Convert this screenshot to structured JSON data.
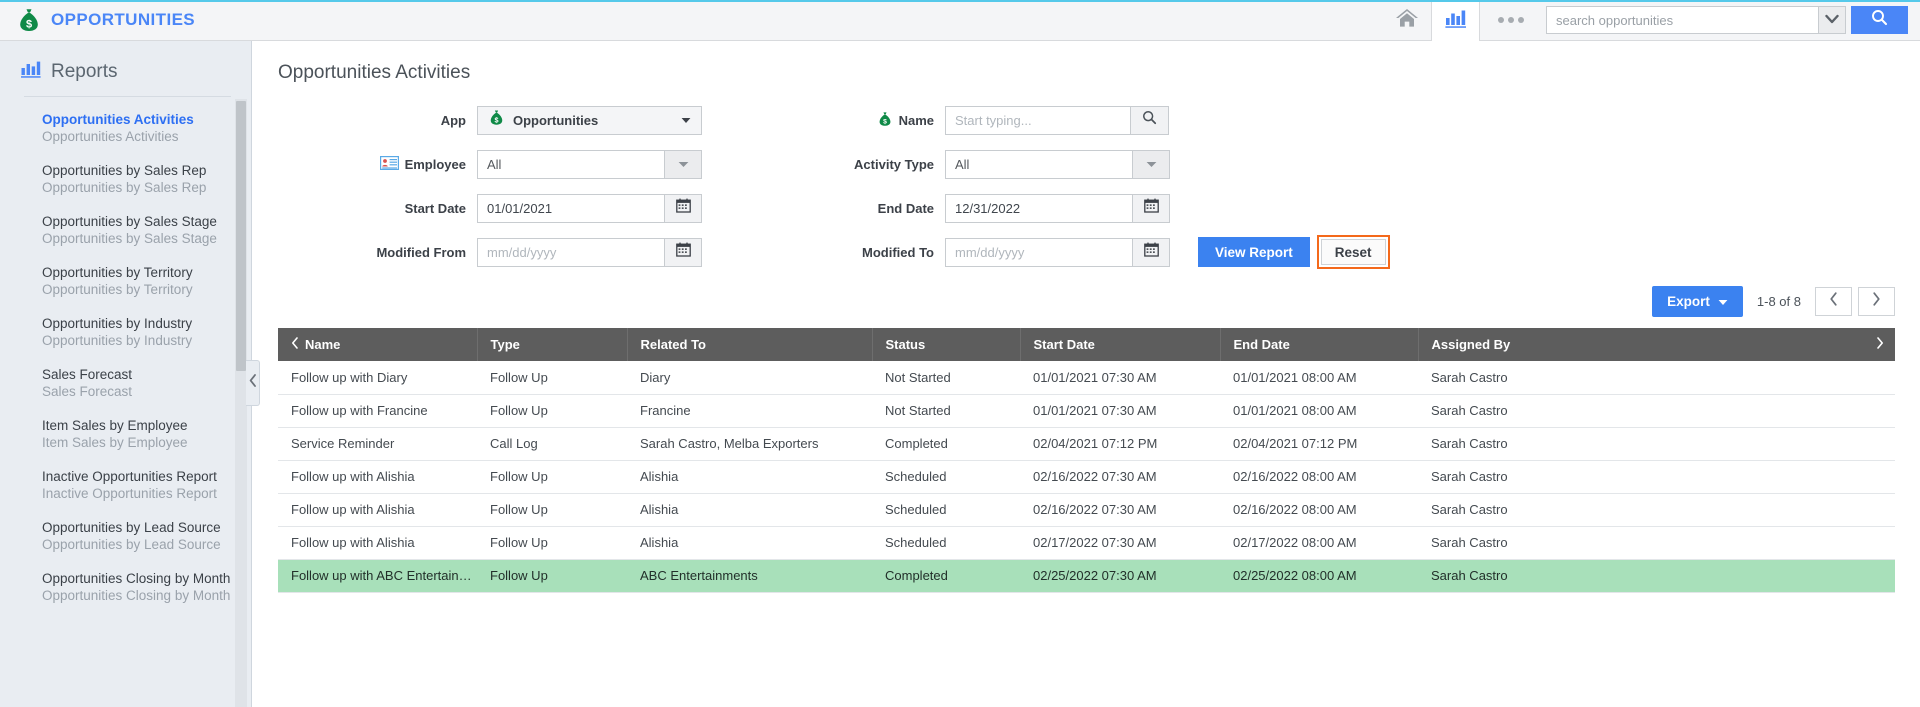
{
  "topbar": {
    "brand": "OPPORTUNITIES",
    "brand_icon": "money-bag-icon",
    "home_icon": "home-icon",
    "reports_icon": "bar-chart-icon",
    "more_icon": "ellipsis-icon",
    "search_placeholder": "search opportunities",
    "search_value": "",
    "search_caret_icon": "chevron-down-icon",
    "search_button_icon": "search-icon",
    "accent_blue": "#4a86f7",
    "top_accent": "#55c9ea"
  },
  "sidebar": {
    "heading": "Reports",
    "heading_icon": "bar-chart-icon",
    "collapse_icon": "chevron-left-icon",
    "items": [
      {
        "title": "Opportunities Activities",
        "subtitle": "Opportunities Activities",
        "active": true
      },
      {
        "title": "Opportunities by Sales Rep",
        "subtitle": "Opportunities by Sales Rep",
        "active": false
      },
      {
        "title": "Opportunities by Sales Stage",
        "subtitle": "Opportunities by Sales Stage",
        "active": false
      },
      {
        "title": "Opportunities by Territory",
        "subtitle": "Opportunities by Territory",
        "active": false
      },
      {
        "title": "Opportunities by Industry",
        "subtitle": "Opportunities by Industry",
        "active": false
      },
      {
        "title": "Sales Forecast",
        "subtitle": "Sales Forecast",
        "active": false
      },
      {
        "title": "Item Sales by Employee",
        "subtitle": "Item Sales by Employee",
        "active": false
      },
      {
        "title": "Inactive Opportunities Report",
        "subtitle": "Inactive Opportunities Report",
        "active": false
      },
      {
        "title": "Opportunities by Lead Source",
        "subtitle": "Opportunities by Lead Source",
        "active": false
      },
      {
        "title": "Opportunities Closing by Month",
        "subtitle": "Opportunities Closing by Month",
        "active": false
      }
    ]
  },
  "main": {
    "page_title": "Opportunities Activities",
    "filters": {
      "app_label": "App",
      "app_value": "Opportunities",
      "app_icon": "money-bag-icon",
      "name_label": "Name",
      "name_icon": "money-bag-icon",
      "name_placeholder": "Start typing...",
      "name_value": "",
      "name_search_icon": "search-icon",
      "employee_label": "Employee",
      "employee_icon": "employee-card-icon",
      "employee_value": "All",
      "activity_type_label": "Activity Type",
      "activity_type_value": "All",
      "start_date_label": "Start Date",
      "start_date_value": "01/01/2021",
      "end_date_label": "End Date",
      "end_date_value": "12/31/2022",
      "modified_from_label": "Modified From",
      "modified_from_value": "",
      "modified_from_placeholder": "mm/dd/yyyy",
      "modified_to_label": "Modified To",
      "modified_to_value": "",
      "modified_to_placeholder": "mm/dd/yyyy",
      "calendar_icon": "calendar-icon",
      "dropdown_icon": "caret-down-icon",
      "view_report_label": "View Report",
      "reset_label": "Reset",
      "reset_highlight_color": "#f4691b"
    },
    "toolbar": {
      "export_label": "Export",
      "export_caret_icon": "caret-down-icon",
      "page_count": "1-8 of 8",
      "prev_icon": "chevron-left-icon",
      "next_icon": "chevron-right-icon"
    },
    "table": {
      "sort_prev_icon": "chevron-left-icon",
      "sort_next_icon": "chevron-right-icon",
      "columns": [
        "Name",
        "Type",
        "Related To",
        "Status",
        "Start Date",
        "End Date",
        "Assigned By"
      ],
      "rows": [
        {
          "name": "Follow up with Diary",
          "type": "Follow Up",
          "related_to": "Diary",
          "status": "Not Started",
          "start_date": "01/01/2021 07:30 AM",
          "end_date": "01/01/2021 08:00 AM",
          "assigned_by": "Sarah Castro",
          "selected": false
        },
        {
          "name": "Follow up with Francine",
          "type": "Follow Up",
          "related_to": "Francine",
          "status": "Not Started",
          "start_date": "01/01/2021 07:30 AM",
          "end_date": "01/01/2021 08:00 AM",
          "assigned_by": "Sarah Castro",
          "selected": false
        },
        {
          "name": "Service Reminder",
          "type": "Call Log",
          "related_to": "Sarah Castro, Melba Exporters",
          "status": "Completed",
          "start_date": "02/04/2021 07:12 PM",
          "end_date": "02/04/2021 07:12 PM",
          "assigned_by": "Sarah Castro",
          "selected": false
        },
        {
          "name": "Follow up with Alishia",
          "type": "Follow Up",
          "related_to": "Alishia",
          "status": "Scheduled",
          "start_date": "02/16/2022 07:30 AM",
          "end_date": "02/16/2022 08:00 AM",
          "assigned_by": "Sarah Castro",
          "selected": false
        },
        {
          "name": "Follow up with Alishia",
          "type": "Follow Up",
          "related_to": "Alishia",
          "status": "Scheduled",
          "start_date": "02/16/2022 07:30 AM",
          "end_date": "02/16/2022 08:00 AM",
          "assigned_by": "Sarah Castro",
          "selected": false
        },
        {
          "name": "Follow up with Alishia",
          "type": "Follow Up",
          "related_to": "Alishia",
          "status": "Scheduled",
          "start_date": "02/17/2022 07:30 AM",
          "end_date": "02/17/2022 08:00 AM",
          "assigned_by": "Sarah Castro",
          "selected": false
        },
        {
          "name": "Follow up with ABC Entertainments",
          "type": "Follow Up",
          "related_to": "ABC Entertainments",
          "status": "Completed",
          "start_date": "02/25/2022 07:30 AM",
          "end_date": "02/25/2022 08:00 AM",
          "assigned_by": "Sarah Castro",
          "selected": true
        }
      ]
    }
  }
}
